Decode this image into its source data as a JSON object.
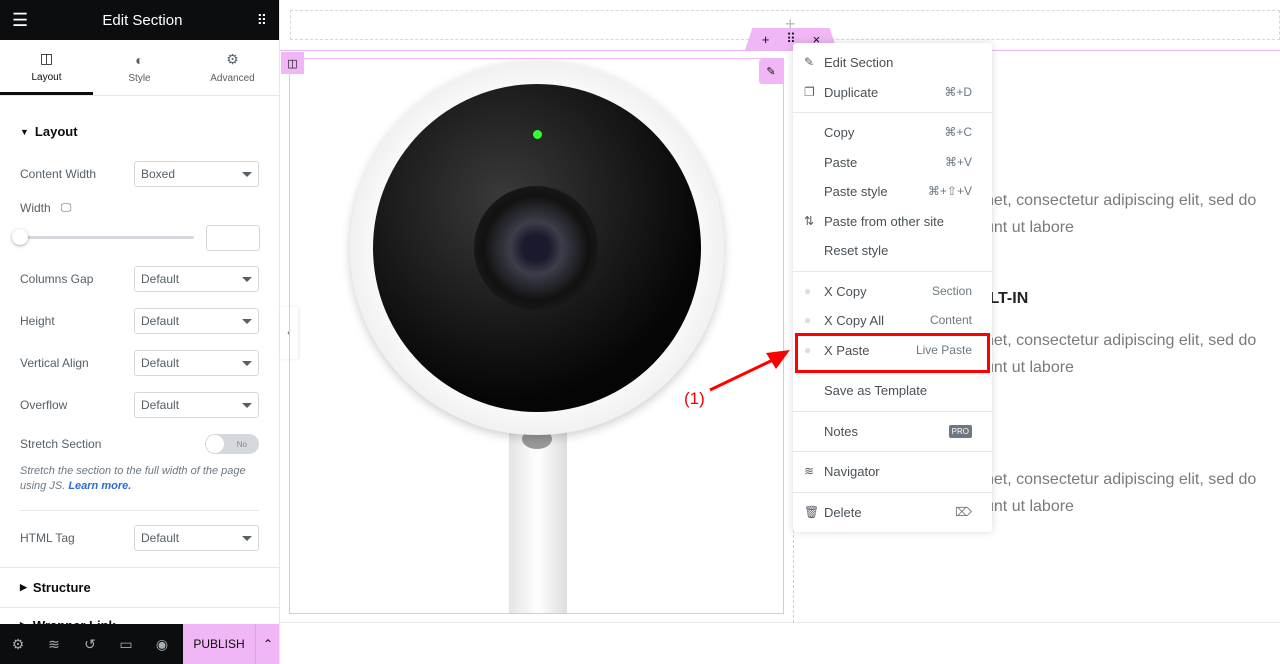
{
  "panel": {
    "title": "Edit Section",
    "tabs": [
      {
        "label": "Layout"
      },
      {
        "label": "Style"
      },
      {
        "label": "Advanced"
      }
    ],
    "section_layout": "Layout",
    "content_width": {
      "label": "Content Width",
      "value": "Boxed"
    },
    "width": {
      "label": "Width",
      "value": ""
    },
    "columns_gap": {
      "label": "Columns Gap",
      "value": "Default"
    },
    "height": {
      "label": "Height",
      "value": "Default"
    },
    "vertical_align": {
      "label": "Vertical Align",
      "value": "Default"
    },
    "overflow": {
      "label": "Overflow",
      "value": "Default"
    },
    "stretch": {
      "label": "Stretch Section",
      "toggle": "No",
      "help": "Stretch the section to the full width of the page using JS.",
      "learn_more": "Learn more."
    },
    "html_tag": {
      "label": "HTML Tag",
      "value": "Default"
    },
    "structure": "Structure",
    "wrapper_link": "Wrapper Link",
    "publish": "PUBLISH"
  },
  "menu": {
    "items": [
      {
        "label": "Edit Section",
        "shortcut": ""
      },
      {
        "label": "Duplicate",
        "shortcut": "⌘+D"
      },
      {
        "label": "Copy",
        "shortcut": "⌘+C"
      },
      {
        "label": "Paste",
        "shortcut": "⌘+V"
      },
      {
        "label": "Paste style",
        "shortcut": "⌘+⇧+V"
      },
      {
        "label": "Paste from other site",
        "shortcut": ""
      },
      {
        "label": "Reset style",
        "shortcut": ""
      },
      {
        "label": "X Copy",
        "shortcut": "Section"
      },
      {
        "label": "X Copy All",
        "shortcut": "Content"
      },
      {
        "label": "X Paste",
        "shortcut": "Live Paste"
      },
      {
        "label": "Save as Template",
        "shortcut": ""
      },
      {
        "label": "Notes",
        "shortcut": "PRO"
      },
      {
        "label": "Navigator",
        "shortcut": ""
      },
      {
        "label": "Delete",
        "shortcut": ""
      }
    ]
  },
  "annotation": "(1)",
  "content": {
    "heading": "ILT-IN",
    "lines": [
      "net, consectetur adipiscing elit, sed do",
      "unt ut labore"
    ]
  },
  "colors": {
    "accent": "#f0b6f5",
    "highlight": "#ff0000",
    "dark": "#0c0d0e"
  }
}
